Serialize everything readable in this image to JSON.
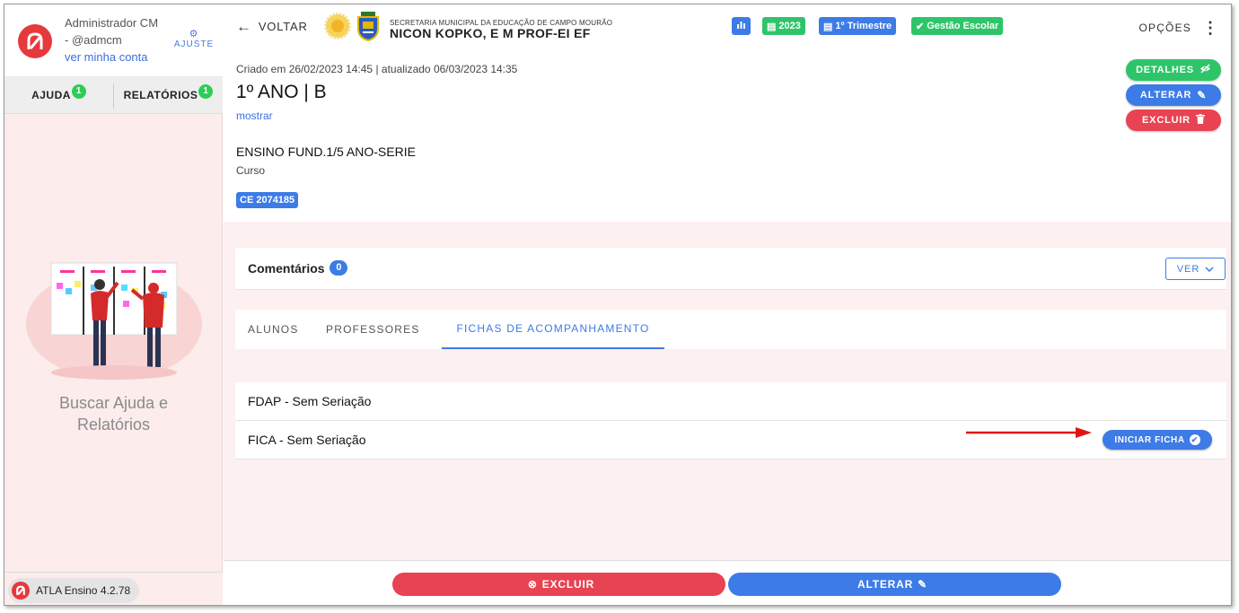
{
  "sidebar": {
    "user": {
      "name": "Administrador CM",
      "handle": "- @admcm",
      "account_link": "ver minha conta",
      "settings_label": "AJUSTE"
    },
    "tabs": [
      {
        "label": "AJUDA",
        "count": "1"
      },
      {
        "label": "RELATÓRIOS",
        "count": "1"
      }
    ],
    "help_text": "Buscar Ajuda e Relatórios",
    "version": "ATLA Ensino 4.2.78"
  },
  "header": {
    "back_label": "VOLTAR",
    "school_sub": "SECRETARIA MUNICIPAL DA EDUCAÇÃO DE CAMPO MOURÃO",
    "school_name": "NICON KOPKO, E M PROF-EI EF",
    "badges": [
      {
        "label": "",
        "icon": "chart-icon",
        "color": "#3d7be6"
      },
      {
        "label": "2023",
        "icon": "calendar-icon",
        "color": "#2ec56a"
      },
      {
        "label": "1º Trimestre",
        "icon": "calendar-icon",
        "color": "#3d7be6"
      },
      {
        "label": "Gestão Escolar",
        "icon": "check-circle-icon",
        "color": "#2ec56a"
      }
    ],
    "options_label": "OPÇÕES"
  },
  "class_info": {
    "meta": "Criado em 26/02/2023 14:45 | atualizado 06/03/2023 14:35",
    "title": "1º ANO | B",
    "show_link": "mostrar",
    "curso_name": "ENSINO FUND.1/5 ANO-SERIE",
    "curso_label": "Curso",
    "ce_badge": "CE 2074185"
  },
  "actions": {
    "details": "DETALHES",
    "edit": "ALTERAR",
    "delete": "EXCLUIR"
  },
  "comments": {
    "title": "Comentários",
    "count": "0",
    "view_label": "VER"
  },
  "tabs": [
    {
      "label": "ALUNOS",
      "active": false
    },
    {
      "label": "PROFESSORES",
      "active": false
    },
    {
      "label": "FICHAS DE ACOMPANHAMENTO",
      "active": true
    }
  ],
  "fichas": [
    {
      "label": "FDAP - Sem Seriação"
    },
    {
      "label": "FICA - Sem Seriação",
      "button": "INICIAR FICHA"
    }
  ],
  "footer": {
    "delete_label": "EXCLUIR",
    "edit_label": "ALTERAR"
  },
  "colors": {
    "primary_blue": "#3d7be6",
    "success_green": "#2ec56a",
    "danger_red": "#e84352",
    "brand_red": "#e6393c"
  }
}
